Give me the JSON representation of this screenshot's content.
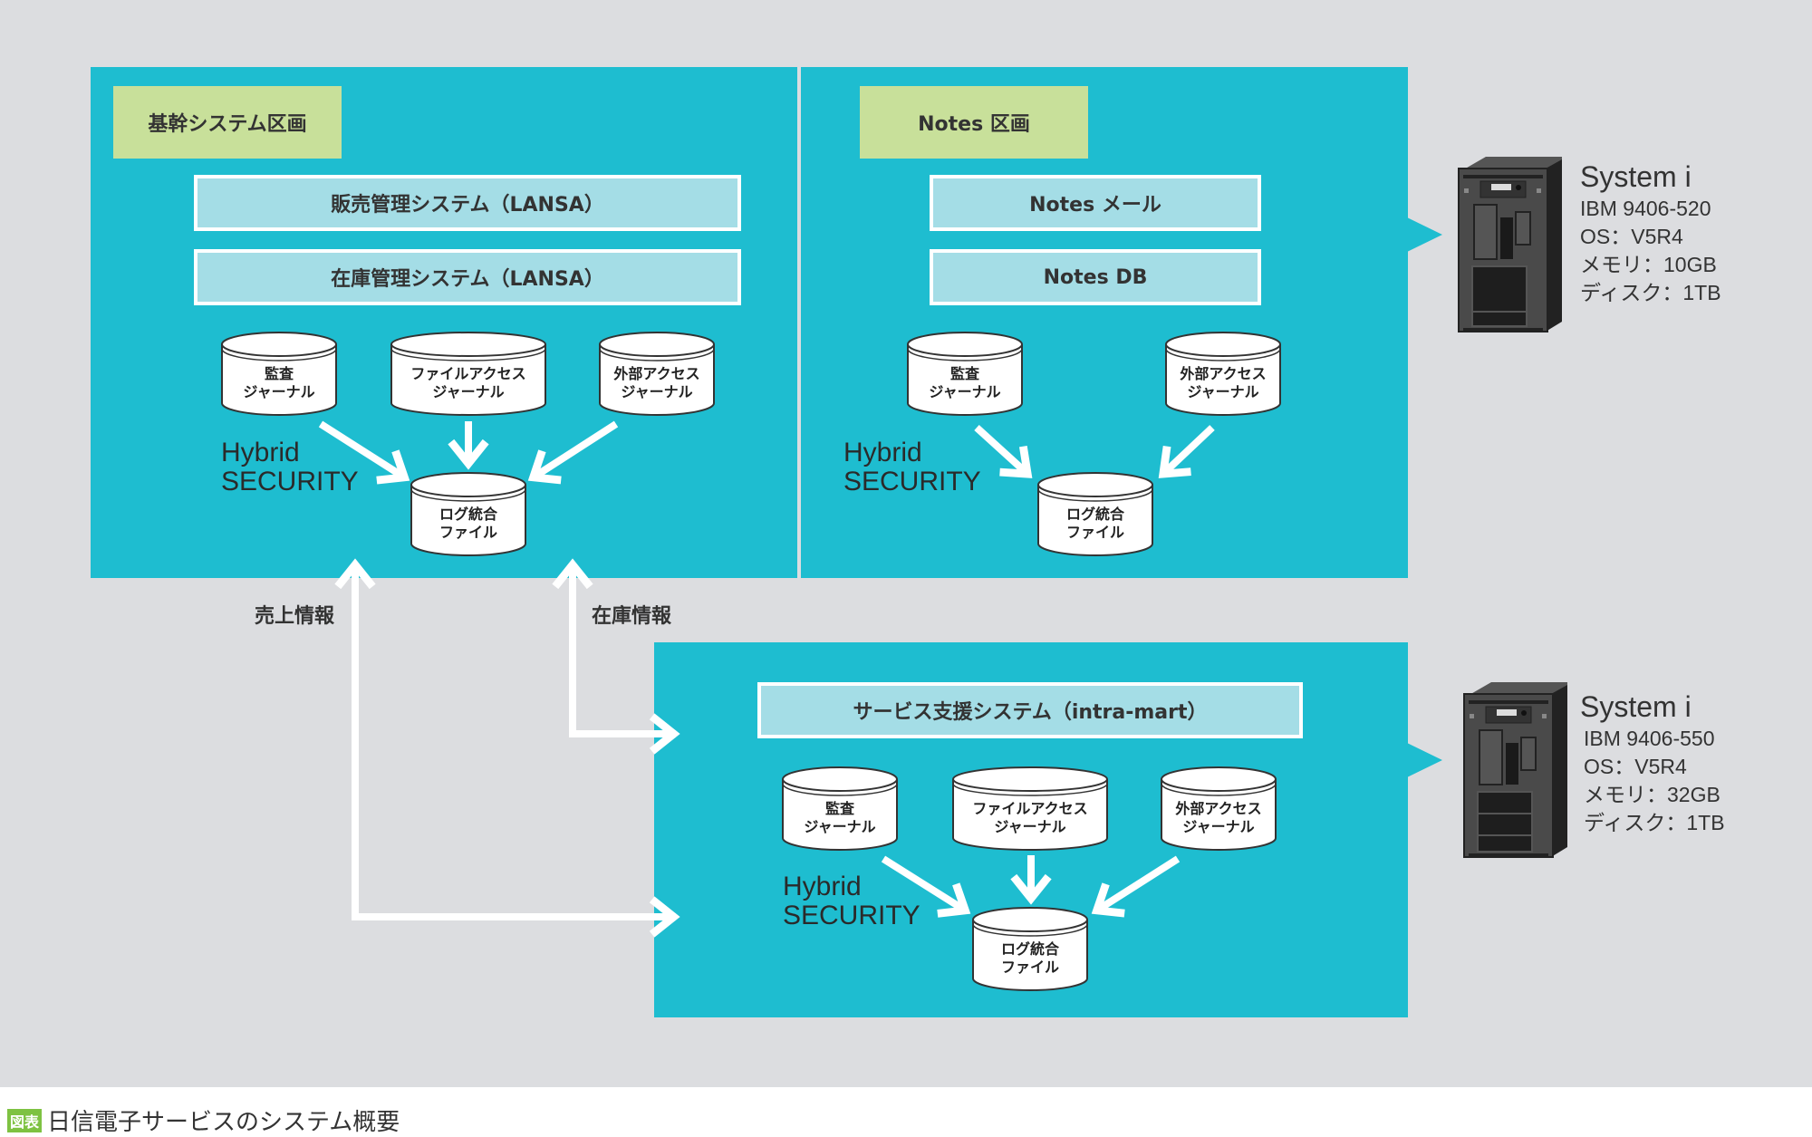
{
  "zones": {
    "core": {
      "label": "基幹システム区画",
      "systems": [
        "販売管理システム（LANSA）",
        "在庫管理システム（LANSA）"
      ],
      "hybrid": [
        "Hybrid",
        "SECURITY"
      ],
      "journals": [
        [
          "監査",
          "ジャーナル"
        ],
        [
          "ファイルアクセス",
          "ジャーナル"
        ],
        [
          "外部アクセス",
          "ジャーナル"
        ]
      ],
      "log": [
        "ログ統合",
        "ファイル"
      ]
    },
    "notes": {
      "label": "Notes 区画",
      "systems": [
        "Notes メール",
        "Notes DB"
      ],
      "hybrid": [
        "Hybrid",
        "SECURITY"
      ],
      "journals": [
        [
          "監査",
          "ジャーナル"
        ],
        [
          "外部アクセス",
          "ジャーナル"
        ]
      ],
      "log": [
        "ログ統合",
        "ファイル"
      ]
    },
    "service": {
      "systems": [
        "サービス支援システム（intra-mart）"
      ],
      "hybrid": [
        "Hybrid",
        "SECURITY"
      ],
      "journals": [
        [
          "監査",
          "ジャーナル"
        ],
        [
          "ファイルアクセス",
          "ジャーナル"
        ],
        [
          "外部アクセス",
          "ジャーナル"
        ]
      ],
      "log": [
        "ログ統合",
        "ファイル"
      ]
    }
  },
  "flows": {
    "sales": "売上情報",
    "inventory": "在庫情報"
  },
  "servers": [
    {
      "title": "System i",
      "model": "IBM 9406-520",
      "os": "OS：V5R4",
      "memory": "メモリ：10GB",
      "disk": "ディスク：1TB"
    },
    {
      "title": "System i",
      "model": "IBM 9406-550",
      "os": "OS：V5R4",
      "memory": "メモリ：32GB",
      "disk": "ディスク：1TB"
    }
  ],
  "caption": {
    "tag": "図表",
    "text": "日信電子サービスのシステム概要"
  },
  "colors": {
    "zone": "#1ebdd0",
    "label": "#c8e09a",
    "system_box": "#a4dde6",
    "background": "#dcdde0"
  }
}
